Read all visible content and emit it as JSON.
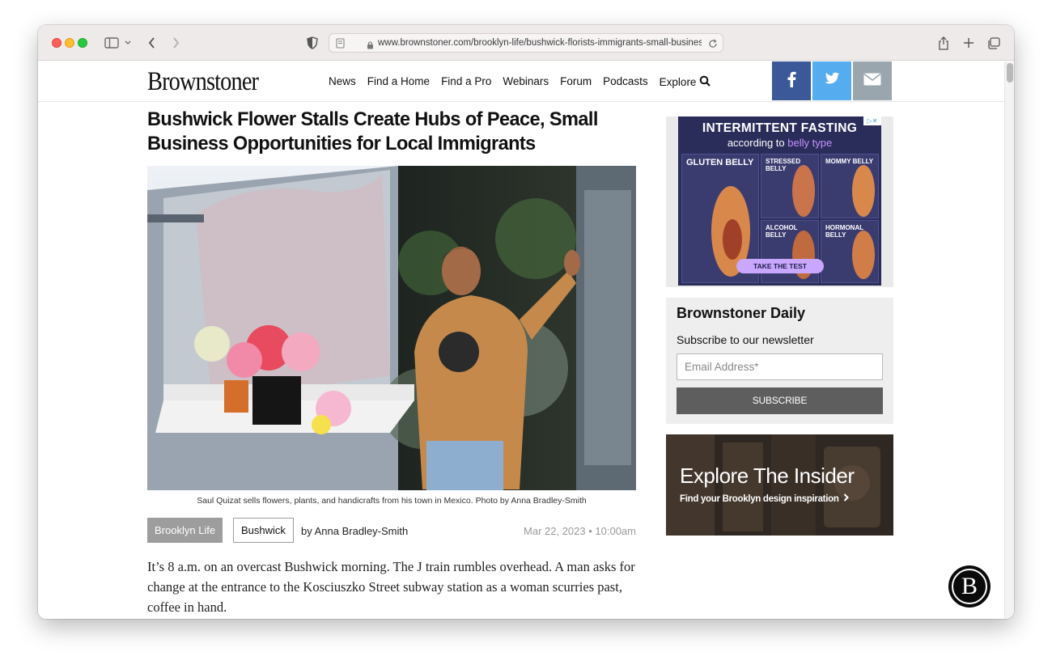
{
  "browser": {
    "url": "www.brownstoner.com/brooklyn-life/bushwick-florists-immigrants-small-business"
  },
  "site": {
    "logo": "Brownstoner",
    "nav": [
      "News",
      "Find a Home",
      "Find a Pro",
      "Webinars",
      "Forum",
      "Podcasts",
      "Explore"
    ],
    "social": [
      "facebook-icon",
      "twitter-icon",
      "email-icon"
    ],
    "colors": {
      "facebook": "#3b5998",
      "twitter": "#55acee",
      "email": "#9aa6ad"
    }
  },
  "article": {
    "title": "Bushwick Flower Stalls Create Hubs of Peace, Small Business Opportunities for Local Immigrants",
    "caption": "Saul Quizat sells flowers, plants, and handicrafts from his town in Mexico. Photo by Anna Bradley-Smith",
    "tags": [
      "Brooklyn Life",
      "Bushwick"
    ],
    "byline": "by Anna Bradley-Smith",
    "date": "Mar 22, 2023 • 10:00am",
    "body": "It’s 8 a.m. on an overcast Bushwick morning. The J train rumbles overhead. A man asks for change at the entrance to the Kosciuszko Street subway station as a woman scurries past, coffee in hand."
  },
  "sidebar": {
    "ad": {
      "headline": "INTERMITTENT FASTING",
      "sub_prefix": "according to",
      "sub_highlight": "belly type",
      "cells": [
        {
          "label": "GLUTEN BELLY"
        },
        {
          "label": "STRESSED BELLY"
        },
        {
          "label": "MOMMY BELLY"
        },
        {
          "label": "ALCOHOL BELLY"
        },
        {
          "label": "HORMONAL BELLY"
        }
      ],
      "cta": "TAKE THE TEST"
    },
    "newsletter": {
      "title": "Brownstoner Daily",
      "subtitle": "Subscribe to our newsletter",
      "placeholder": "Email Address*",
      "button": "SUBSCRIBE"
    },
    "insider": {
      "title": "Explore The Insider",
      "subtitle": "Find your Brooklyn design inspiration"
    }
  },
  "floating_button": "B"
}
